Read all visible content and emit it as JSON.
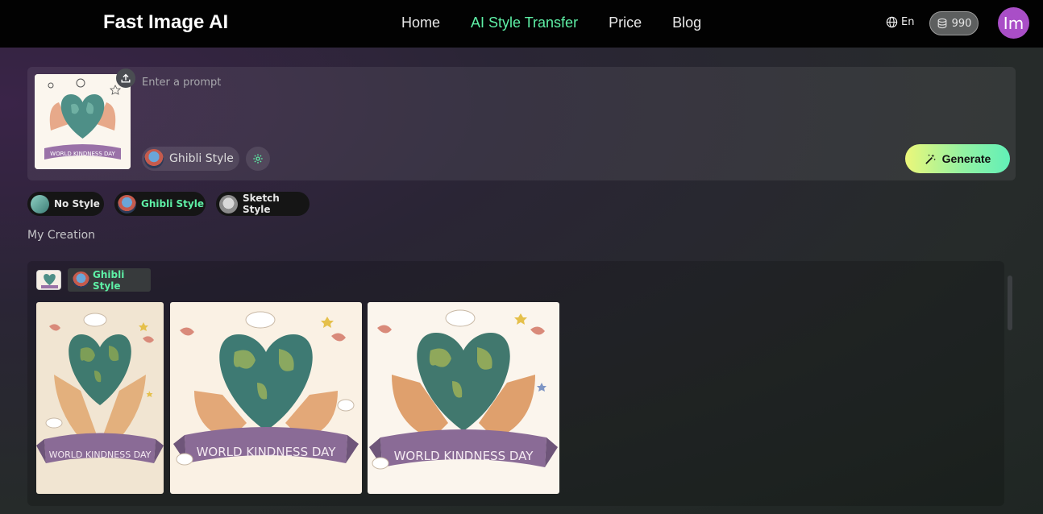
{
  "nav": {
    "brand": "Fast Image AI",
    "items": [
      {
        "label": "Home",
        "active": false
      },
      {
        "label": "AI Style Transfer",
        "active": true
      },
      {
        "label": "Price",
        "active": false
      },
      {
        "label": "Blog",
        "active": false
      }
    ],
    "language": "En",
    "credits": "990",
    "avatar_initials": "Im",
    "accent_color": "#5ef0a6",
    "avatar_color": "#a94ec7"
  },
  "prompt": {
    "placeholder": "Enter a prompt",
    "selected_style": "Ghibli Style",
    "generate_label": "Generate"
  },
  "styles": [
    {
      "label": "No Style",
      "active": false
    },
    {
      "label": "Ghibli Style",
      "active": true
    },
    {
      "label": "Sketch Style",
      "active": false
    }
  ],
  "creation": {
    "title": "My Creation",
    "style_label": "Ghibli Style",
    "results": [
      {
        "banner_text": "WORLD KINDNESS DAY"
      },
      {
        "banner_text": "WORLD KINDNESS DAY"
      },
      {
        "banner_text": "WORLD KINDNESS DAY"
      }
    ]
  },
  "upload_image": {
    "banner_text": "WORLD KINDNESS DAY"
  }
}
